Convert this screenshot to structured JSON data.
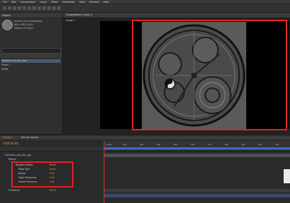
{
  "menu": [
    "File",
    "Edit",
    "Composition",
    "Layer",
    "Effect",
    "Animation",
    "View",
    "Window",
    "Help"
  ],
  "project": {
    "tab": "Project",
    "footage_name": "timeline_and_bladiko.jpg",
    "footage_info_1": "800 x 800 (1.00)",
    "footage_info_2": "Millions of Colors",
    "items": [
      {
        "name": "timeline_and_bla...jpg"
      },
      {
        "name": "Comp 1"
      },
      {
        "name": "Solids"
      }
    ]
  },
  "viewer": {
    "tab": "Composition: Comp 1",
    "sub": "Comp 1"
  },
  "timeline": {
    "tab": "Comp 1",
    "render": "Render Queue",
    "timecode": "0:00:00:00",
    "ticks": [
      "0:00s",
      "02s",
      "04s",
      "06s",
      "08s",
      "10s",
      "12s",
      "14s",
      "16s",
      "18s",
      "20s"
    ],
    "rows": [
      {
        "label": "1  timeline_and_bla...jpg",
        "value": ""
      },
      {
        "label": "Effects",
        "value": ""
      },
      {
        "label": "Roughen Edges",
        "value": "Reset"
      },
      {
        "label": "Edge Type",
        "value": "Rusty"
      },
      {
        "label": "Border",
        "value": "8.00"
      },
      {
        "label": "Edge Sharpness",
        "value": "1.00"
      },
      {
        "label": "Fractal Influence",
        "value": "1.00"
      },
      {
        "label": "Transform",
        "value": "Reset"
      }
    ]
  },
  "colors": {
    "highlight": "#e32222",
    "timecode": "#e8a03a",
    "workarea": "#3b6fc6"
  }
}
